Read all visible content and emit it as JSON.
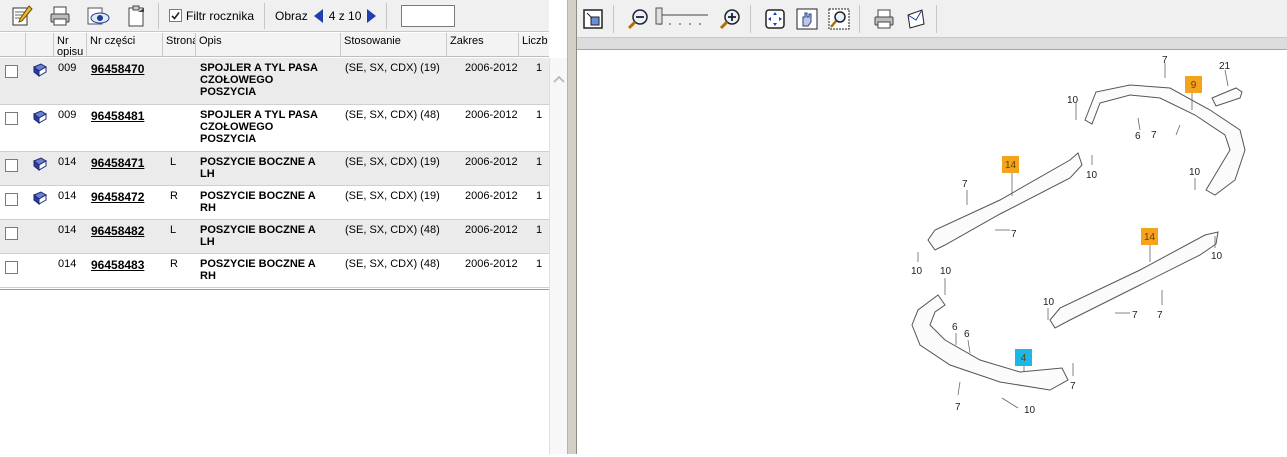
{
  "left_toolbar": {
    "filter_label": "Filtr rocznika",
    "filter_checked": true,
    "obraz_label": "Obraz",
    "page_of": "4 z 10",
    "page_input_value": ""
  },
  "columns": [
    "Nr opisu",
    "Nr części",
    "Strona",
    "Opis",
    "Stosowanie",
    "Zakres",
    "Liczba"
  ],
  "column_headers_visible": {
    "nr_opisu": "Nr opisu",
    "nr_czesci": "Nr części",
    "strona": "Strona",
    "opis": "Opis",
    "stosowanie": "Stosowanie",
    "zakres": "Zakres",
    "liczba": "Liczb"
  },
  "rows": [
    {
      "book": true,
      "nr": "009",
      "part": "96458470",
      "side": "",
      "desc_lines": [
        "SPOJLER A TYL PASA",
        "CZOŁOWEGO",
        "POSZYCIA"
      ],
      "app": "(SE, SX, CDX) (19)",
      "range": "2006-2012",
      "qty": "1",
      "selected": true
    },
    {
      "book": true,
      "nr": "009",
      "part": "96458481",
      "side": "",
      "desc_lines": [
        "SPOJLER A TYL PASA",
        "CZOŁOWEGO",
        "POSZYCIA"
      ],
      "app": "(SE, SX, CDX) (48)",
      "range": "2006-2012",
      "qty": "1",
      "selected": false
    },
    {
      "book": true,
      "nr": "014",
      "part": "96458471",
      "side": "L",
      "desc_lines": [
        "POSZYCIE BOCZNE A",
        "LH"
      ],
      "app": "(SE, SX, CDX) (19)",
      "range": "2006-2012",
      "qty": "1",
      "selected": true
    },
    {
      "book": true,
      "nr": "014",
      "part": "96458472",
      "side": "R",
      "desc_lines": [
        "POSZYCIE BOCZNE A",
        "RH"
      ],
      "app": "(SE, SX, CDX) (19)",
      "range": "2006-2012",
      "qty": "1",
      "selected": false
    },
    {
      "book": false,
      "nr": "014",
      "part": "96458482",
      "side": "L",
      "desc_lines": [
        "POSZYCIE BOCZNE A",
        "LH"
      ],
      "app": "(SE, SX, CDX) (48)",
      "range": "2006-2012",
      "qty": "1",
      "selected": true
    },
    {
      "book": false,
      "nr": "014",
      "part": "96458483",
      "side": "R",
      "desc_lines": [
        "POSZYCIE BOCZNE A",
        "RH"
      ],
      "app": "(SE, SX, CDX) (48)",
      "range": "2006-2012",
      "qty": "1",
      "selected": false
    }
  ],
  "diagram_labels": {
    "callouts": [
      {
        "text": "9",
        "color": "#f4a41c"
      },
      {
        "text": "14",
        "color": "#f4a41c"
      },
      {
        "text": "14",
        "color": "#f4a41c"
      },
      {
        "text": "4",
        "color": "#19b8e8"
      }
    ],
    "numbers": [
      "7",
      "21",
      "10",
      "6",
      "7",
      "10",
      "10",
      "7",
      "7",
      "10",
      "10",
      "10",
      "10",
      "7",
      "7",
      "6",
      "6",
      "7",
      "7",
      "10"
    ]
  },
  "colors": {
    "toolbar_bg": "#f0f0f0",
    "selected_row": "#ebebeb",
    "nav_arrow": "#1f3fae",
    "callout_orange": "#f4a41c",
    "callout_blue": "#19b8e8",
    "splitter": "#d4d0c8"
  },
  "icons": {
    "left_toolbar": [
      "edit-notepad-icon",
      "print-icon",
      "preview-eye-icon",
      "export-clipboard-icon"
    ],
    "right_toolbar": [
      "fit-window-icon",
      "zoom-out-icon",
      "zoom-in-icon",
      "center-view-icon",
      "pan-hand-icon",
      "zoom-area-icon",
      "print-icon",
      "send-mail-icon"
    ],
    "row": "book-icon"
  }
}
